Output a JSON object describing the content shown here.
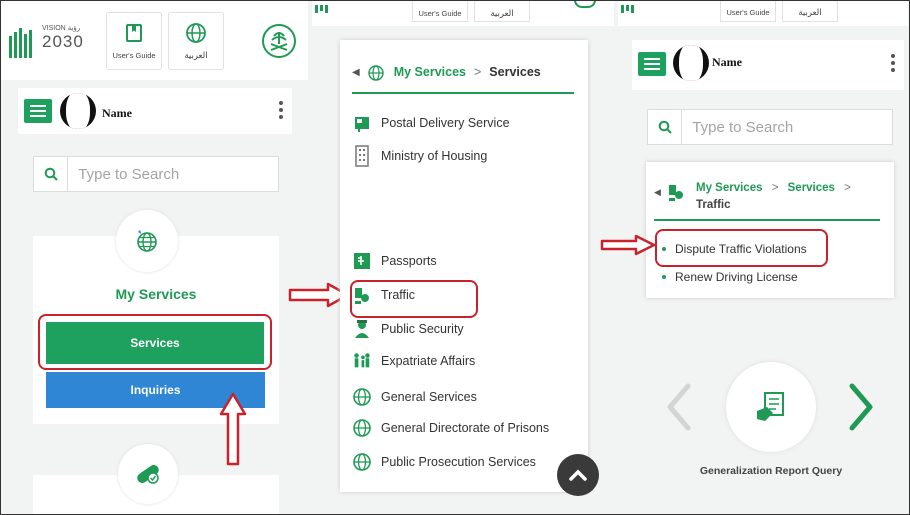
{
  "colors": {
    "green": "#1ea05e",
    "blue": "#2f86d4",
    "red": "#c8232c"
  },
  "left": {
    "logo_line1": "VISION رؤية",
    "logo_line2": "2030",
    "users_guide": "User's Guide",
    "arabic": "العربية",
    "user_name": "Name",
    "search_placeholder": "Type to Search",
    "my_services": "My Services",
    "services_button": "Services",
    "inquiries_button": "Inquiries"
  },
  "middle": {
    "top_users_guide": "User's Guide",
    "top_arabic": "العربية",
    "breadcrumb_my_services": "My Services",
    "breadcrumb_sep": ">",
    "breadcrumb_services": "Services",
    "items": [
      "Postal Delivery Service",
      "Ministry of Housing",
      "Passports",
      "Traffic",
      "Public Security",
      "Expatriate Affairs",
      "General Services",
      "General Directorate of Prisons",
      "Public Prosecution Services"
    ]
  },
  "right": {
    "top_users_guide": "User's Guide",
    "top_arabic": "العربية",
    "user_name": "Name",
    "search_placeholder": "Type to Search",
    "breadcrumb_my_services": "My Services",
    "breadcrumb_sep": ">",
    "breadcrumb_services": "Services",
    "breadcrumb_sep2": ">",
    "breadcrumb_traffic": "Traffic",
    "links": [
      "Dispute Traffic Violations",
      "Renew Driving License"
    ],
    "generalization_report": "Generalization Report Query"
  }
}
